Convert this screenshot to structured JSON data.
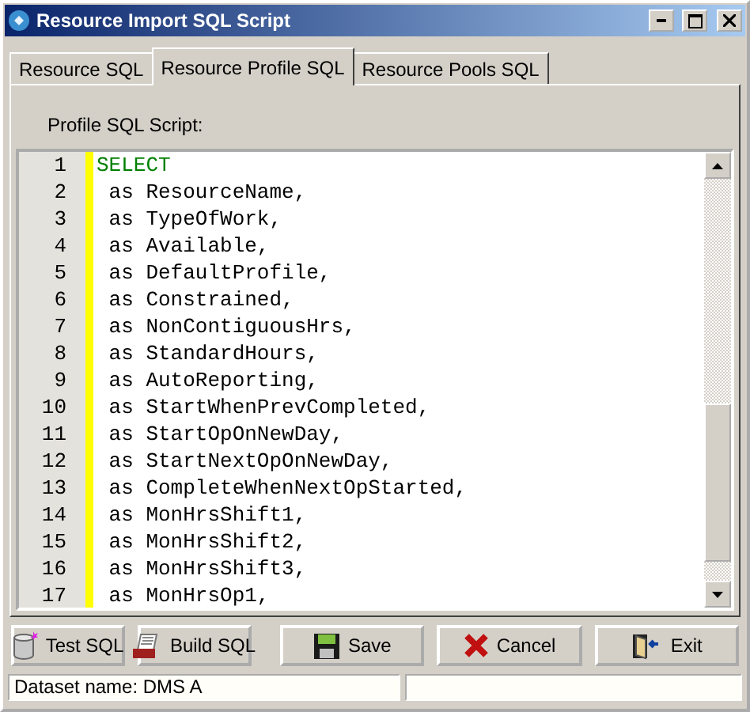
{
  "window": {
    "title": "Resource Import SQL Script"
  },
  "tabs": [
    {
      "label": "Resource SQL",
      "selected": false
    },
    {
      "label": "Resource Profile SQL",
      "selected": true
    },
    {
      "label": "Resource Pools SQL",
      "selected": false
    }
  ],
  "script_label": "Profile SQL Script:",
  "editor": {
    "lines": [
      {
        "number": "1",
        "kind": "keyword",
        "text": "SELECT"
      },
      {
        "number": "2",
        "kind": "plain",
        "text": " as ResourceName,"
      },
      {
        "number": "3",
        "kind": "plain",
        "text": " as TypeOfWork,"
      },
      {
        "number": "4",
        "kind": "plain",
        "text": " as Available,"
      },
      {
        "number": "5",
        "kind": "plain",
        "text": " as DefaultProfile,"
      },
      {
        "number": "6",
        "kind": "plain",
        "text": " as Constrained,"
      },
      {
        "number": "7",
        "kind": "plain",
        "text": " as NonContiguousHrs,"
      },
      {
        "number": "8",
        "kind": "plain",
        "text": " as StandardHours,"
      },
      {
        "number": "9",
        "kind": "plain",
        "text": " as AutoReporting,"
      },
      {
        "number": "10",
        "kind": "plain",
        "text": " as StartWhenPrevCompleted,"
      },
      {
        "number": "11",
        "kind": "plain",
        "text": " as StartOpOnNewDay,"
      },
      {
        "number": "12",
        "kind": "plain",
        "text": " as StartNextOpOnNewDay,"
      },
      {
        "number": "13",
        "kind": "plain",
        "text": " as CompleteWhenNextOpStarted,"
      },
      {
        "number": "14",
        "kind": "plain",
        "text": " as MonHrsShift1,"
      },
      {
        "number": "15",
        "kind": "plain",
        "text": " as MonHrsShift2,"
      },
      {
        "number": "16",
        "kind": "plain",
        "text": " as MonHrsShift3,"
      },
      {
        "number": "17",
        "kind": "plain",
        "text": " as MonHrsOp1,"
      }
    ]
  },
  "buttons": [
    {
      "label": "Test SQL",
      "kind": "test"
    },
    {
      "label": "Build SQL",
      "kind": "build"
    },
    {
      "label": "Save",
      "kind": "save"
    },
    {
      "label": "Cancel",
      "kind": "cancel"
    },
    {
      "label": "Exit",
      "kind": "exit"
    }
  ],
  "status_bar": {
    "dataset": "Dataset name:  DMS A"
  }
}
